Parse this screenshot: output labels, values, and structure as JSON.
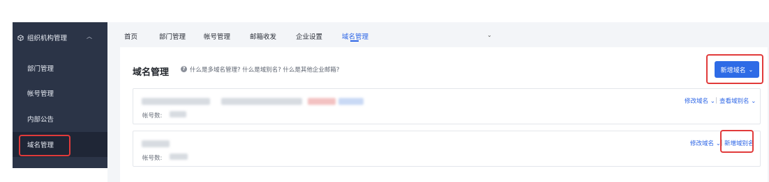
{
  "sidebar": {
    "group_label": "组织机构管理",
    "items": [
      {
        "label": "部门管理"
      },
      {
        "label": "帐号管理"
      },
      {
        "label": "内部公告"
      },
      {
        "label": "域名管理"
      }
    ]
  },
  "tabs": [
    {
      "label": "首页"
    },
    {
      "label": "部门管理"
    },
    {
      "label": "帐号管理"
    },
    {
      "label": "邮箱收发"
    },
    {
      "label": "企业设置"
    },
    {
      "label": "域名管理"
    }
  ],
  "page": {
    "title": "域名管理",
    "help_text": "什么是多域名管理? 什么是域别名? 什么是其他企业邮箱?",
    "new_domain_button": "新增域名"
  },
  "domains": [
    {
      "account_label": "帐号数:",
      "actions": [
        "修改域名",
        "查看域别名"
      ]
    },
    {
      "account_label": "帐号数:",
      "actions": [
        "修改域名",
        "新增域别名"
      ]
    }
  ],
  "colors": {
    "sidebar_bg": "#2b3447",
    "accent": "#2e6be6",
    "highlight_border": "#e13a3a"
  }
}
